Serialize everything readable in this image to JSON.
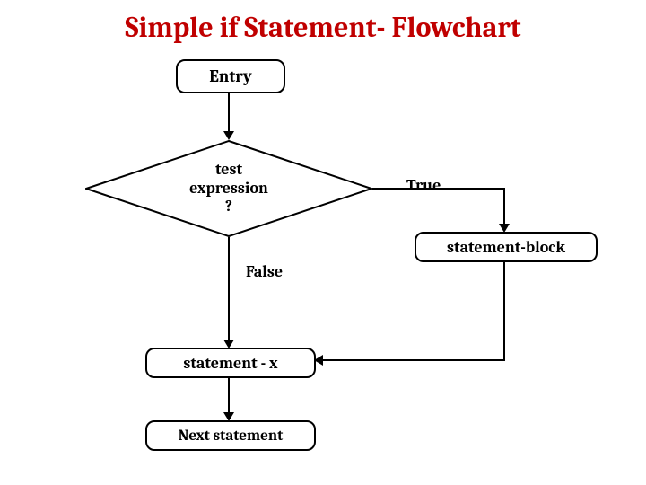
{
  "title": "Simple if Statement- Flowchart",
  "nodes": {
    "entry": "Entry",
    "decision": "test\nexpression\n?",
    "stmt_block": "statement-block",
    "stmt_x": "statement - x",
    "next": "Next statement"
  },
  "labels": {
    "true": "True",
    "false": "False"
  }
}
